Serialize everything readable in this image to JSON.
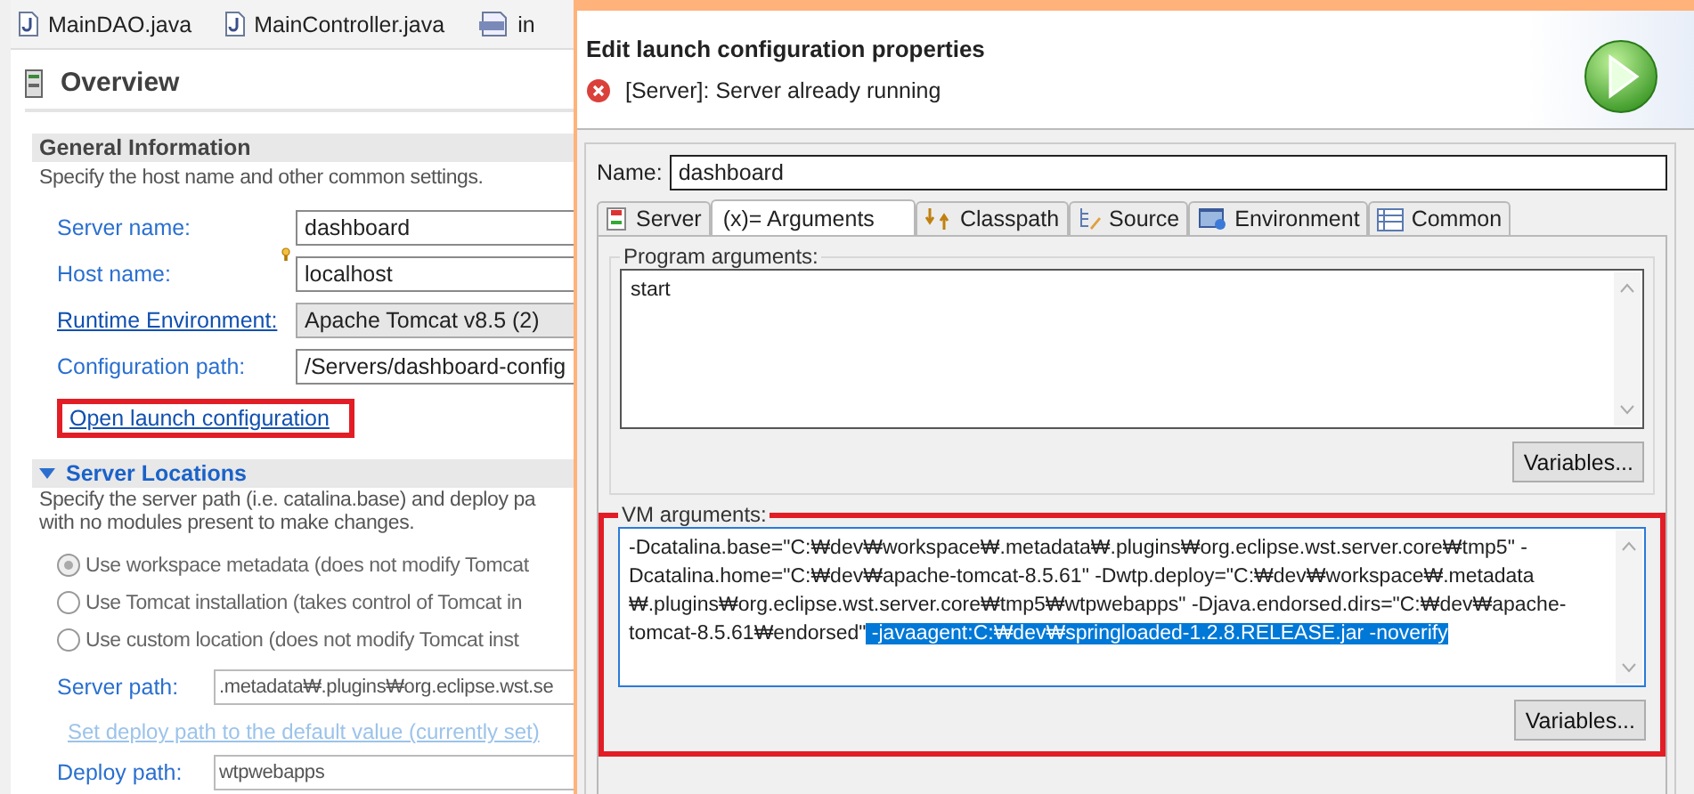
{
  "editor_tabs": [
    {
      "label": "MainDAO.java",
      "kind": "java"
    },
    {
      "label": "MainController.java",
      "kind": "java"
    },
    {
      "label": "in",
      "kind": "jsp"
    }
  ],
  "overview": {
    "title": "Overview",
    "general": {
      "title": "General Information",
      "description": "Specify the host name and other common settings.",
      "fields": [
        {
          "label": "Server name:",
          "value": "dashboard",
          "kind": "text",
          "label_link": false,
          "hint": false
        },
        {
          "label": "Host name:",
          "value": "localhost",
          "kind": "text",
          "label_link": false,
          "hint": true
        },
        {
          "label": "Runtime Environment:",
          "value": "Apache Tomcat v8.5 (2)",
          "kind": "combo",
          "label_link": true,
          "hint": false
        },
        {
          "label": "Configuration path:",
          "value": "/Servers/dashboard-config",
          "kind": "text",
          "label_link": false,
          "hint": false
        }
      ],
      "link": {
        "label": "Open launch configuration",
        "highlighted": true
      }
    },
    "locations": {
      "title": "Server Locations",
      "expanded": true,
      "description": [
        "Specify the server path (i.e. catalina.base) and deploy pa",
        "with no modules present to make changes."
      ],
      "options": [
        {
          "label": "Use workspace metadata (does not modify Tomcat",
          "selected": true,
          "disabled": true
        },
        {
          "label": "Use Tomcat installation (takes control of Tomcat in",
          "selected": false,
          "disabled": true
        },
        {
          "label": "Use custom location (does not modify Tomcat inst",
          "selected": false,
          "disabled": true
        }
      ],
      "server_path": {
        "label": "Server path:",
        "value": ".metadata₩.plugins₩org.eclipse.wst.se"
      },
      "deploy_link": {
        "label": "Set deploy path to the default value (currently set)",
        "disabled": true
      },
      "deploy_path": {
        "label": "Deploy path:",
        "value": "wtpwebapps"
      }
    }
  },
  "dialog": {
    "title": "Edit launch configuration properties",
    "message": {
      "kind": "error",
      "text": "[Server]: Server already running"
    },
    "name": {
      "label": "Name:",
      "value": "dashboard"
    },
    "tabs": [
      {
        "label": "Server",
        "kind": "server",
        "selected": false
      },
      {
        "label": "(x)= Arguments",
        "kind": "none",
        "selected": true
      },
      {
        "label": "Classpath",
        "kind": "classpath",
        "selected": false
      },
      {
        "label": "Source",
        "kind": "source",
        "selected": false
      },
      {
        "label": "Environment",
        "kind": "environment",
        "selected": false
      },
      {
        "label": "Common",
        "kind": "common",
        "selected": false
      }
    ],
    "program_arguments": {
      "label": "Program arguments:",
      "value": "start",
      "button": "Variables...",
      "highlighted": false
    },
    "vm_arguments": {
      "label": "VM arguments:",
      "value": "-Dcatalina.base=\"C:₩dev₩workspace₩.metadata₩.plugins₩org.eclipse.wst.server.core₩tmp5\" -Dcatalina.home=\"C:₩dev₩apache-tomcat-8.5.61\" -Dwtp.deploy=\"C:₩dev₩workspace₩.metadata ₩.plugins₩org.eclipse.wst.server.core₩tmp5₩wtpwebapps\" -Djava.endorsed.dirs=\"C:₩dev₩apache-tomcat-8.5.61₩endorsed\"",
      "selection": " -javaagent:C:₩dev₩springloaded-1.2.8.RELEASE.jar -noverify",
      "button": "Variables...",
      "highlighted": true
    }
  }
}
